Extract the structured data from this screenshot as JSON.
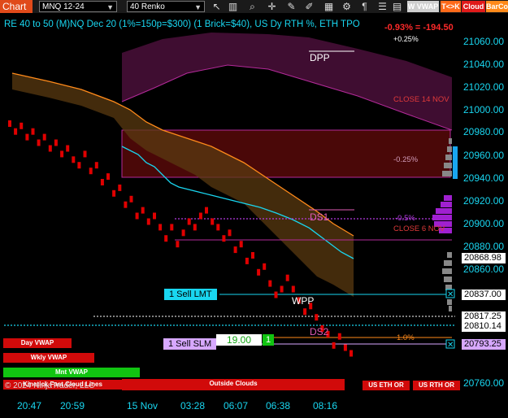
{
  "toolbar": {
    "chart_tab": "Chart",
    "symbol": "MNQ 12-24",
    "bar_type": "40 Renko",
    "icons": [
      "pointer-icon",
      "bar-chart-icon",
      "magnifier-icon",
      "crosshair-icon",
      "draw-icon",
      "data-box-icon",
      "properties-icon"
    ],
    "btn_wvwap": "W VWAP",
    "btn_tk": "T<>K",
    "btn_cloud": "Cloud",
    "btn_barco": "BarCo"
  },
  "chart": {
    "title": "RE 40 to 50 (M)NQ Dec 20 (1%=150p=$300) (1 Brick=$40), US Dy RTH %, ETH TPO",
    "change": "-0.93% = -194.50",
    "change_sub": "+0.25%",
    "price_labels": [
      "21060.00",
      "21040.00",
      "21020.00",
      "21000.00",
      "20980.00",
      "20960.00",
      "20940.00",
      "20920.00",
      "20900.00",
      "20880.00",
      "20860.00",
      "20760.00"
    ],
    "price_boxes": [
      {
        "text": "20868.98",
        "bg": "#ffffff",
        "fg": "#000000"
      },
      {
        "text": "20837.00",
        "bg": "#ffffff",
        "fg": "#000000"
      },
      {
        "text": "20817.25",
        "bg": "#ffffff",
        "fg": "#000000"
      },
      {
        "text": "20810.14",
        "bg": "#ffffff",
        "fg": "#000000"
      },
      {
        "text": "20793.25",
        "bg": "#d7a8ff",
        "fg": "#000000"
      }
    ],
    "time_labels": [
      "20:47",
      "20:59",
      "15 Nov",
      "03:28",
      "06:07",
      "06:38",
      "08:16"
    ],
    "annotations": {
      "dpp": "DPP",
      "close14": "CLOSE 14 NOV",
      "pct_025": "-0.25%",
      "ds1": "DS1",
      "pct_05": "-0.5%",
      "close6": "CLOSE 6 NOV",
      "wpp": "WPP",
      "ds2": "DS2",
      "pct_10": "1.0%"
    },
    "orders": {
      "sell_lmt": "1 Sell LMT",
      "sell_slm": "1 Sell SLM",
      "qty_value": "19.00",
      "qty": "1"
    },
    "bottom_buttons": {
      "day_vwap": "Day VWAP",
      "wkly_vwap": "Wkly VWAP",
      "mnt_vwap": "Mnt VWAP",
      "cloud_lines": "Kinetick Fast Cloud Lines",
      "outside_clouds": "Outside Clouds",
      "us_eth_or": "US ETH OR",
      "us_rth_or": "US RTH OR"
    },
    "copyright": "© 2024 NinjaTrader, LLC"
  },
  "chart_data": {
    "type": "renko",
    "brick_size_usd": 40,
    "bricks": [
      20997,
      20990,
      20995,
      20985,
      20990,
      20980,
      20985,
      20975,
      20980,
      20970,
      20975,
      20965,
      20960,
      20970,
      20955,
      20960,
      20945,
      20950,
      20935,
      20940,
      20925,
      20930,
      20915,
      20920,
      20910,
      20915,
      20905,
      20895,
      20905,
      20890,
      20900,
      20910,
      20905,
      20915,
      20920,
      20910,
      20905,
      20895,
      20900,
      20885,
      20890,
      20875,
      20880,
      20865,
      20870,
      20855,
      20845,
      20850,
      20860,
      20850,
      20840,
      20830,
      20835,
      20825,
      20815,
      20810,
      20800,
      20808,
      20798,
      20793
    ],
    "series": [
      {
        "values": [
          20972,
          20965,
          20955,
          20945,
          20935,
          20930,
          20925,
          20922,
          20920,
          20918,
          20915,
          20912,
          20910,
          20908,
          20905,
          20903,
          20900,
          20898,
          20895,
          20892,
          20889,
          20884,
          20879,
          20875,
          20872,
          20869
        ]
      },
      {
        "values": [
          21050,
          21045,
          21040,
          21035,
          21030,
          21028,
          21025,
          21020,
          21015,
          21005,
          20995,
          20985,
          20975,
          20965,
          20955,
          20945,
          20938,
          20930,
          20925,
          20920,
          20916,
          20912,
          20905,
          20896,
          20888,
          20882
        ]
      }
    ],
    "price_range": [
      20750,
      21075
    ]
  }
}
